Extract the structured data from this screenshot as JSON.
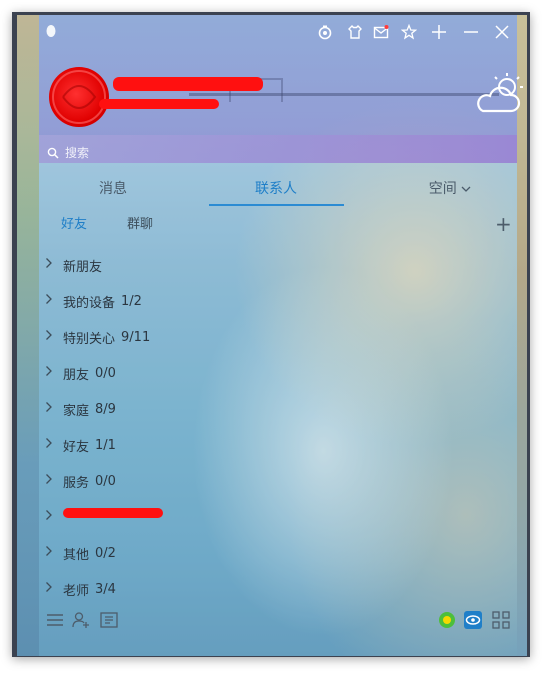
{
  "search": {
    "placeholder": "搜索"
  },
  "tabs": [
    {
      "label": "消息",
      "active": false
    },
    {
      "label": "联系人",
      "active": true
    },
    {
      "label": "空间",
      "active": false
    }
  ],
  "subtabs": [
    {
      "label": "好友",
      "active": true
    },
    {
      "label": "群聊",
      "active": false
    }
  ],
  "add_label": "+",
  "groups": [
    {
      "name": "新朋友",
      "count": ""
    },
    {
      "name": "我的设备",
      "count": "1/2"
    },
    {
      "name": "特别关心",
      "count": "9/11"
    },
    {
      "name": "朋友",
      "count": "0/0"
    },
    {
      "name": "家庭",
      "count": "8/9"
    },
    {
      "name": "好友",
      "count": "1/1"
    },
    {
      "name": "服务",
      "count": "0/0"
    },
    {
      "name": "",
      "count": "",
      "redacted": true
    },
    {
      "name": "其他",
      "count": "0/2"
    },
    {
      "name": "老师",
      "count": "3/4"
    }
  ],
  "titlebar_icons": [
    "timer-icon",
    "shirt-icon",
    "mail-icon",
    "star-icon",
    "add-icon",
    "minimize-icon",
    "close-icon"
  ],
  "colors": {
    "accent": "#1f7fc8",
    "redaction": "#ff1010"
  }
}
